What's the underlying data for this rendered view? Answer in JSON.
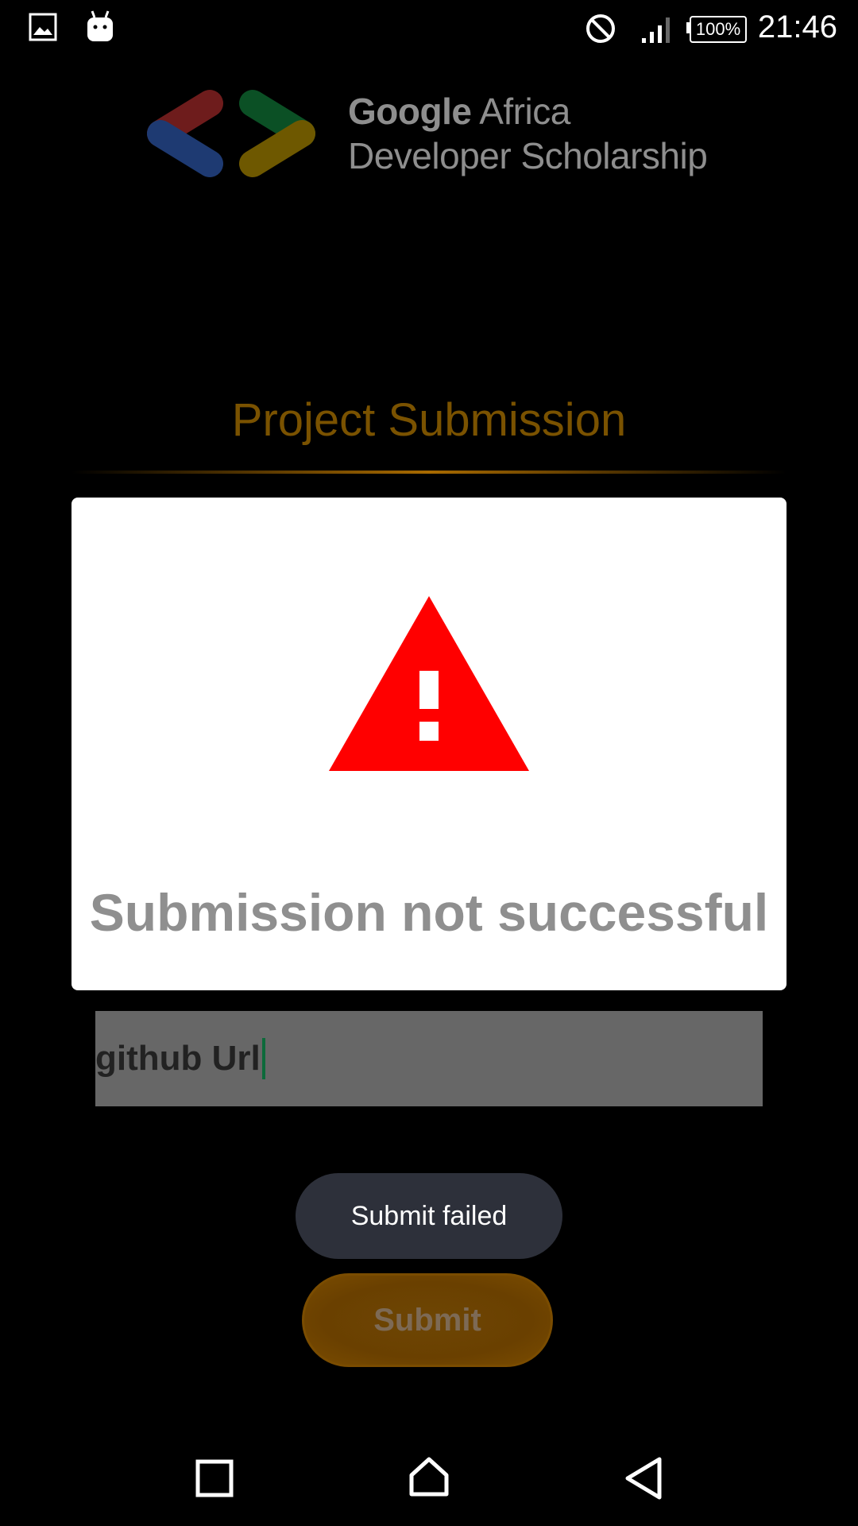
{
  "status_bar": {
    "time": "21:46",
    "battery": "100%",
    "icons": [
      "gallery-icon",
      "android-icon",
      "do-not-disturb-icon",
      "signal-icon",
      "battery-icon"
    ]
  },
  "header": {
    "brand_line1_bold": "Google",
    "brand_line1_rest": " Africa",
    "brand_line2": "Developer Scholarship",
    "logo_colors": [
      "#7a1f1f",
      "#1e3f7a",
      "#0c5a2a",
      "#7a6000"
    ]
  },
  "page": {
    "title": "Project Submission"
  },
  "dialog": {
    "icon": "warning-icon",
    "message": "Submission not successful",
    "icon_color": "#ff0000"
  },
  "form": {
    "github_url_value": "github Url"
  },
  "toast": {
    "message": "Submit failed"
  },
  "submit_button": {
    "label": "Submit"
  },
  "nav_bar": {
    "icons": [
      "recents-icon",
      "home-icon",
      "back-icon"
    ]
  }
}
